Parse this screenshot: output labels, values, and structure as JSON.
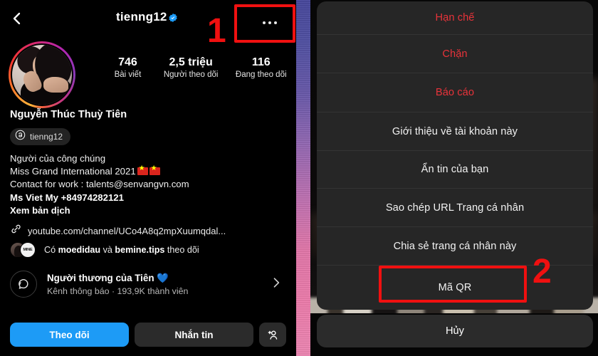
{
  "profile": {
    "header": {
      "back_icon": "chevron-left-icon",
      "username": "tienng12",
      "verified_icon": "verified-badge-icon",
      "more_icon": "three-dots-icon"
    },
    "avatar": {
      "icon": "profile-avatar",
      "has_story_ring": true
    },
    "stats": [
      {
        "value": "746",
        "label": "Bài viết"
      },
      {
        "value": "2,5 triệu",
        "label": "Người theo dõi"
      },
      {
        "value": "116",
        "label": "Đang theo dõi"
      }
    ],
    "full_name": "Nguyễn Thúc Thuỳ Tiên",
    "threads_chip": {
      "icon": "threads-icon",
      "label": "tienng12"
    },
    "bio": {
      "line1": "Người của công chúng",
      "line2_text": "Miss Grand International 2021",
      "line3": "Contact for work : talents@senvangvn.com",
      "line4": "Ms Viet My +84974282121",
      "flags": 2
    },
    "translate_label": "Xem bản dịch",
    "link": {
      "icon": "link-icon",
      "text": "youtube.com/channel/UCo4A8q2mpXuumqdal..."
    },
    "mutual": {
      "prefix": "Có ",
      "name1": "moedidau",
      "middle": " và ",
      "name2": "bemine.tips",
      "suffix": " theo dõi"
    },
    "channel": {
      "icon": "broadcast-channel-icon",
      "title": "Người thương của Tiên 💙",
      "subtitle": "Kênh thông báo · 193,9K thành viên",
      "chevron_icon": "chevron-right-icon"
    },
    "actions": {
      "follow_label": "Theo dõi",
      "message_label": "Nhắn tin",
      "add_user_icon": "add-user-icon"
    }
  },
  "action_sheet": {
    "items": [
      {
        "label": "Hạn chế",
        "style": "danger"
      },
      {
        "label": "Chặn",
        "style": "danger"
      },
      {
        "label": "Báo cáo",
        "style": "danger"
      },
      {
        "label": "Giới thiệu về tài khoản này",
        "style": "normal"
      },
      {
        "label": "Ẩn tin của bạn",
        "style": "normal"
      },
      {
        "label": "Sao chép URL Trang cá nhân",
        "style": "normal"
      },
      {
        "label": "Chia sẻ trang cá nhân này",
        "style": "normal"
      },
      {
        "label": "Mã QR",
        "style": "normal"
      }
    ],
    "cancel_label": "Hủy"
  },
  "annotations": {
    "step1": "1",
    "step2": "2",
    "color": "#f01010"
  },
  "colors": {
    "accent_blue": "#1d9bf6",
    "danger_red": "#e8333a",
    "sheet_bg": "#262626",
    "background": "#000000",
    "annotation_red": "#f01010"
  }
}
